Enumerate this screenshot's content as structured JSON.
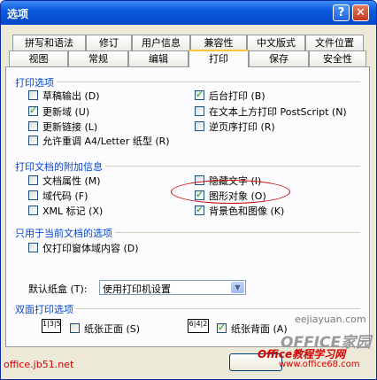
{
  "window": {
    "title": "选项",
    "help_label": "?",
    "close_label": "✕"
  },
  "tabs_row1": [
    "拼写和语法",
    "修订",
    "用户信息",
    "兼容性",
    "中文版式",
    "文件位置"
  ],
  "tabs_row2": [
    "视图",
    "常规",
    "编辑",
    "打印",
    "保存",
    "安全性"
  ],
  "active_tab": "打印",
  "print_options": {
    "title": "打印选项",
    "draft": "草稿输出 (D)",
    "update_fields": "更新域 (U)",
    "update_links": "更新链接 (L)",
    "allow_resize": "允许重调 A4/Letter 纸型 (R)",
    "background_print": "后台打印 (B)",
    "postscript": "在文本上方打印 PostScript (N)",
    "reverse_order": "逆页序打印 (R)"
  },
  "include": {
    "title": "打印文档的附加信息",
    "doc_props": "文档属性 (M)",
    "field_codes": "域代码 (F)",
    "xml_tags": "XML 标记 (X)",
    "hidden_text": "隐藏文字 (I)",
    "drawing_objects": "图形对象 (O)",
    "background": "背景色和图像 (K)"
  },
  "current_doc": {
    "title": "只用于当前文档的选项",
    "form_data": "仅打印窗体域内容 (D)"
  },
  "tray": {
    "label": "默认纸盒 (T):",
    "value": "使用打印机设置",
    "arrow": "▼"
  },
  "duplex": {
    "title": "双面打印选项",
    "front_label": "纸张正面 (S)",
    "back_label": "纸张背面 (A)",
    "front_icon": "1|3|5",
    "back_icon": "6|4|2"
  },
  "watermarks": {
    "left": "office.jb51.net",
    "url": "eejiayuan.com",
    "brand": "OFFICE家园",
    "site_cn": "Office教程学习网",
    "site": "www.office68.com"
  }
}
